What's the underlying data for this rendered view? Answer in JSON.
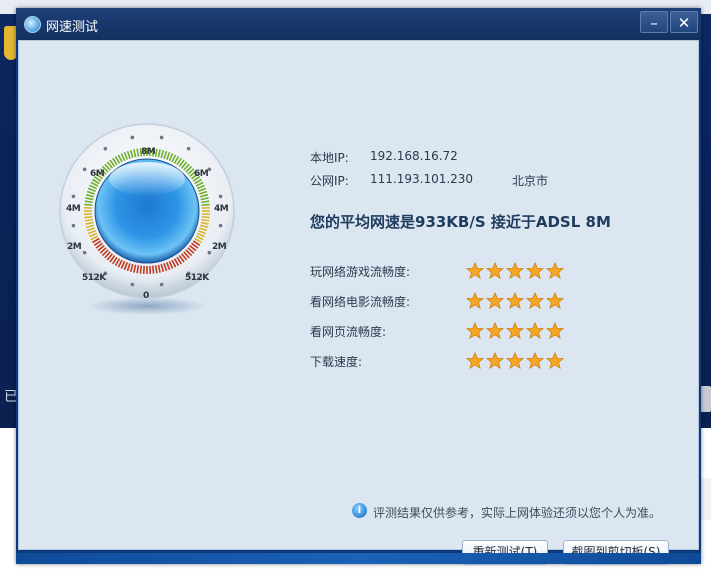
{
  "window": {
    "title": "网速测试",
    "minimize_label": "–",
    "close_label": "✕"
  },
  "desktop": {
    "left_char": "已"
  },
  "gauge": {
    "ticks": {
      "top": "8M",
      "upper_left": "6M",
      "upper_right": "6M",
      "mid_left": "4M",
      "mid_right": "4M",
      "lower_left": "2M",
      "lower_right": "2M",
      "bottom_left": "512K",
      "bottom_right": "512K",
      "bottom": "0"
    }
  },
  "info": {
    "local_ip_label": "本地IP:",
    "local_ip_value": "192.168.16.72",
    "public_ip_label": "公网IP:",
    "public_ip_value": "111.193.101.230",
    "location": "北京市",
    "headline": "您的平均网速是933KB/S 接近于ADSL 8M"
  },
  "ratings": [
    {
      "label": "玩网络游戏流畅度:",
      "stars": 5
    },
    {
      "label": "看网络电影流畅度:",
      "stars": 5
    },
    {
      "label": "看网页流畅度:",
      "stars": 5
    },
    {
      "label": "下载速度:",
      "stars": 5
    }
  ],
  "note": {
    "icon": "info-icon",
    "text": "评测结果仅供参考，实际上网体验还须以您个人为准。"
  },
  "buttons": {
    "retest": "重新测试(T)",
    "copy": "截图到剪切板(S)"
  },
  "colors": {
    "accent": "#1f3c5e",
    "content_bg": "#dbe6f1",
    "title_bar": "#1d3f78",
    "star": "#f5a623"
  }
}
